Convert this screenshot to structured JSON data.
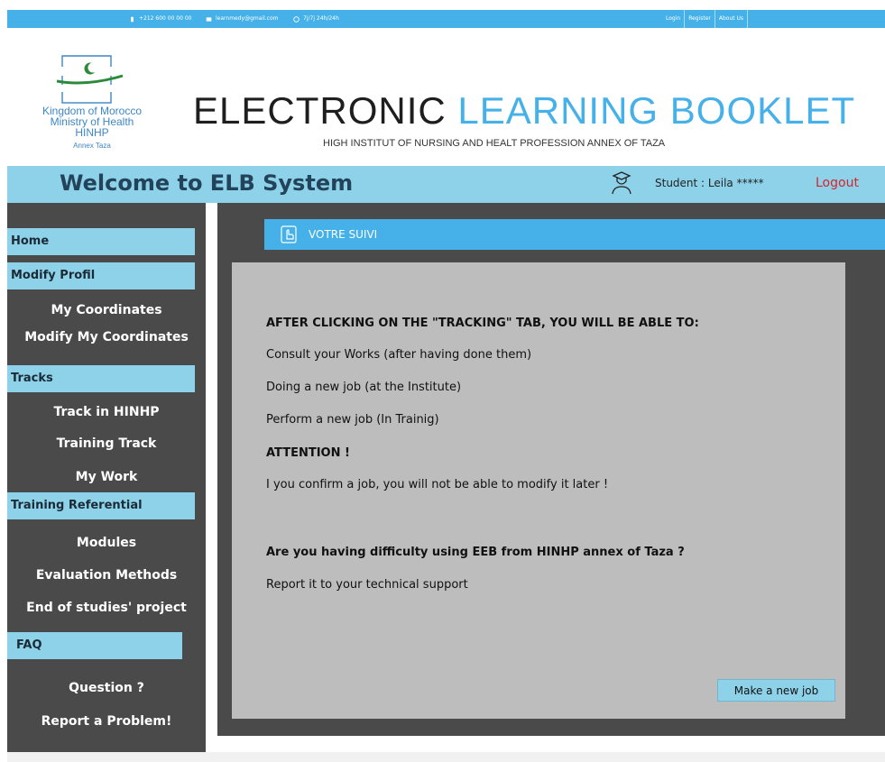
{
  "topbar": {
    "phone": "+212 600 00 00 00",
    "email": "learnmedy@gmail.com",
    "hours": "7j/7j 24h/24h",
    "links": [
      "Login",
      "Register",
      "About Us"
    ]
  },
  "logo": {
    "line1": "Kingdom of Morocco",
    "line2": "Ministry of Health",
    "line3": "HINHP",
    "line4": "Annex Taza"
  },
  "header": {
    "title_part1": "ELECTRONIC",
    "title_part2": "LEARNING BOOKLET",
    "subtitle": "HIGH INSTITUT OF NURSING AND HEALT PROFESSION ANNEX OF TAZA"
  },
  "welcome": {
    "title": "Welcome to ELB System",
    "student": "Student : Leila *****",
    "logout": "Logout"
  },
  "sidebar": {
    "home": "Home",
    "modify_profil": "Modify Profil",
    "my_coordinates": "My Coordinates",
    "modify_my_coordinates": "Modify My Coordinates",
    "tracks": "Tracks",
    "track_in_hinhp": "Track in HINHP",
    "training_track": "Training Track",
    "my_work": "My Work",
    "training_referential": "Training Referential",
    "modules": "Modules",
    "evaluation_methods": "Evaluation Methods",
    "end_of_studies_project": "End of studies' project",
    "faq": "FAQ",
    "question": "Question ?",
    "report_problem": "Report a Problem!"
  },
  "main": {
    "tab_label": "VOTRE SUIVI",
    "line1": "AFTER CLICKING ON THE \"TRACKING\" TAB, YOU WILL BE ABLE TO:",
    "line2": "Consult your Works (after having done them)",
    "line3": "Doing a new job (at the Institute)",
    "line4": "Perform a new job (In Trainig)",
    "line5": "ATTENTION !",
    "line6": "I you confirm a job, you will not be able to modify it later !",
    "line7": "Are you having difficulty using EEB from  HINHP annex of  Taza  ?",
    "line8": "Report it to your technical support",
    "button": "Make a new job"
  },
  "colors": {
    "accent_blue": "#45b1e8",
    "light_blue": "#8ed2e9",
    "dark_gray": "#4a4a4a",
    "content_gray": "#bdbdbd",
    "logout_red": "#d9232b"
  }
}
